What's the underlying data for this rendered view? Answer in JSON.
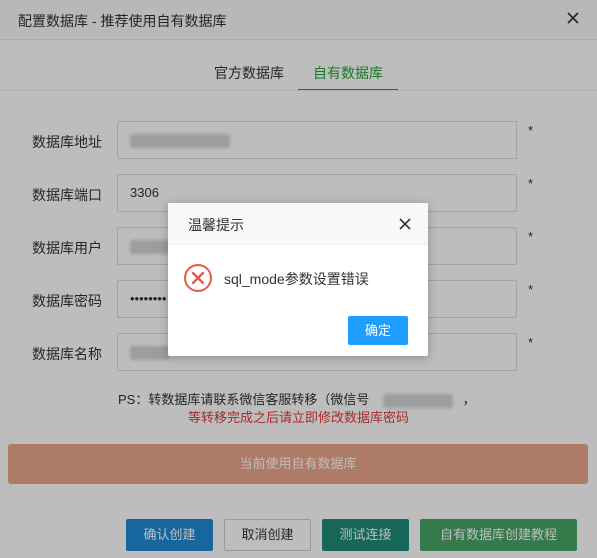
{
  "header": {
    "title": "配置数据库 - 推荐使用自有数据库",
    "close_icon": "close-icon"
  },
  "tabs": [
    {
      "label": "官方数据库",
      "active": false
    },
    {
      "label": "自有数据库",
      "active": true
    }
  ],
  "form": {
    "address": {
      "label": "数据库地址",
      "value": ""
    },
    "port": {
      "label": "数据库端口",
      "value": "3306"
    },
    "user": {
      "label": "数据库用户",
      "value": ""
    },
    "password": {
      "label": "数据库密码",
      "value": "••••••••"
    },
    "name": {
      "label": "数据库名称",
      "value": ""
    },
    "required_mark": "*"
  },
  "notice": {
    "ps": "PS：转数据库请联系微信客服转移（微信号",
    "ps_suffix": "，",
    "warning": "等转移完成之后请立即修改数据库密码"
  },
  "wide_button": "当前使用自有数据库",
  "buttons": {
    "confirm": "确认创建",
    "cancel": "取消创建",
    "test": "测试连接",
    "tutorial": "自有数据库创建教程"
  },
  "dialog": {
    "title": "温馨提示",
    "message": "sql_mode参数设置错误",
    "ok": "确定",
    "icon": "error-circle-icon"
  },
  "colors": {
    "accent_green": "#20a53a",
    "warning_red": "#e03a3a",
    "primary_blue": "#1e9fff"
  }
}
